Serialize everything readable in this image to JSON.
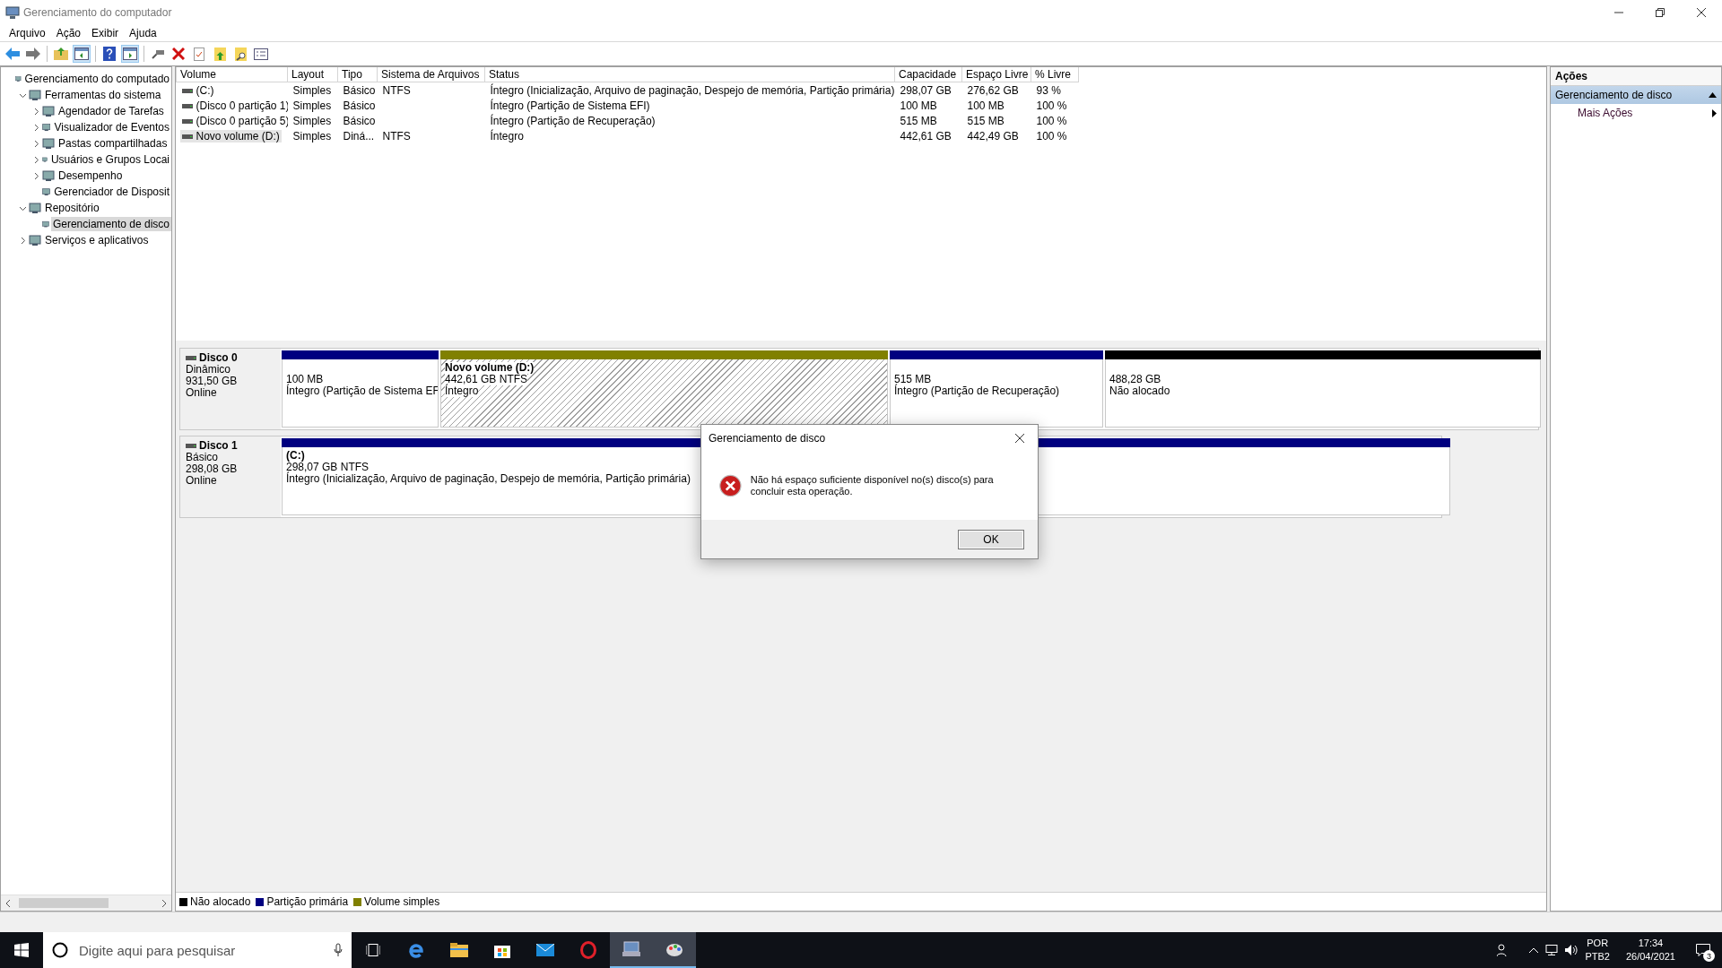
{
  "window": {
    "title": "Gerenciamento do computador"
  },
  "menu": [
    "Arquivo",
    "Ação",
    "Exibir",
    "Ajuda"
  ],
  "toolbar": [
    {
      "pressed": false
    },
    {
      "pressed": false
    },
    {
      "pressed": false
    },
    {
      "pressed": true
    },
    {
      "pressed": false
    },
    {
      "pressed": true
    },
    {
      "pressed": false
    },
    {
      "pressed": false
    },
    {
      "pressed": false
    },
    {
      "pressed": false
    },
    {
      "pressed": false
    },
    {
      "pressed": false
    }
  ],
  "tree": [
    {
      "label": "Gerenciamento do computado",
      "selected": false,
      "children": [
        {
          "label": "Ferramentas do sistema",
          "selected": false,
          "expanded": true,
          "children": [
            {
              "label": "Agendador de Tarefas",
              "selected": false,
              "expanded": false
            },
            {
              "label": "Visualizador de Eventos",
              "selected": false,
              "expanded": false
            },
            {
              "label": "Pastas compartilhadas",
              "selected": false,
              "expanded": false
            },
            {
              "label": "Usuários e Grupos Locai",
              "selected": false,
              "expanded": false
            },
            {
              "label": "Desempenho",
              "selected": false,
              "expanded": false
            },
            {
              "label": "Gerenciador de Disposit",
              "selected": false
            }
          ]
        },
        {
          "label": "Repositório",
          "selected": false,
          "expanded": true,
          "children": [
            {
              "label": "Gerenciamento de disco",
              "selected": true
            }
          ]
        },
        {
          "label": "Serviços e aplicativos",
          "selected": false,
          "expanded": false
        }
      ]
    }
  ],
  "table": {
    "columns": [
      "Volume",
      "Layout",
      "Tipo",
      "Sistema de Arquivos",
      "Status",
      "Capacidade",
      "Espaço Livre",
      "% Livre"
    ],
    "rows": [
      {
        "selected": false,
        "cells": [
          "(C:)",
          "Simples",
          "Básico",
          "NTFS",
          "Íntegro (Inicialização, Arquivo de paginação, Despejo de memória, Partição primária)",
          "298,07 GB",
          "276,62 GB",
          "93 %"
        ]
      },
      {
        "selected": false,
        "cells": [
          "(Disco 0 partição 1)",
          "Simples",
          "Básico",
          "",
          "Íntegro (Partição de Sistema EFI)",
          "100 MB",
          "100 MB",
          "100 %"
        ]
      },
      {
        "selected": false,
        "cells": [
          "(Disco 0 partição 5)",
          "Simples",
          "Básico",
          "",
          "Íntegro (Partição de Recuperação)",
          "515 MB",
          "515 MB",
          "100 %"
        ]
      },
      {
        "selected": true,
        "cells": [
          "Novo volume (D:)",
          "Simples",
          "Diná...",
          "NTFS",
          "Íntegro",
          "442,61 GB",
          "442,49 GB",
          "100 %"
        ]
      }
    ]
  },
  "disks": [
    {
      "name": "Disco 0",
      "type": "Dinâmico",
      "size": "931,50 GB",
      "status": "Online",
      "partitions": [
        {
          "kind": "primary",
          "selected": false,
          "size": "100 MB",
          "status": "Íntegro (Partição de Sistema EF"
        },
        {
          "kind": "simple",
          "selected": true,
          "name": "Novo volume  (D:)",
          "size": "442,61 GB NTFS",
          "status": "Íntegro"
        },
        {
          "kind": "primary",
          "selected": false,
          "size": "515 MB",
          "status": "Íntegro (Partição de Recuperação)"
        },
        {
          "kind": "unallocated",
          "selected": false,
          "size": "488,28 GB",
          "status": "Não alocado"
        }
      ]
    },
    {
      "name": "Disco 1",
      "type": "Básico",
      "size": "298,08 GB",
      "status": "Online",
      "partitions": [
        {
          "kind": "primary",
          "selected": false,
          "name": "(C:)",
          "size": "298,07 GB NTFS",
          "status": "Íntegro (Inicialização, Arquivo de paginação, Despejo de memória, Partição primária)"
        }
      ]
    }
  ],
  "legend": [
    {
      "label": "Não alocado",
      "color": "#000000"
    },
    {
      "label": "Partição primária",
      "color": "#000080"
    },
    {
      "label": "Volume simples",
      "color": "#808000"
    }
  ],
  "actions": {
    "title": "Ações",
    "section": {
      "label": "Gerenciamento de disco",
      "expanded": true
    },
    "items": [
      "Mais Ações"
    ]
  },
  "dialog": {
    "title": "Gerenciamento de disco",
    "message": "Não há espaço suficiente disponível no(s) disco(s) para concluir esta operação.",
    "button": "OK"
  },
  "taskbar": {
    "search_placeholder": "Digite aqui para pesquisar",
    "language": "POR",
    "layout": "PTB2",
    "time": "17:34",
    "date": "26/04/2021",
    "notifications": "3"
  }
}
